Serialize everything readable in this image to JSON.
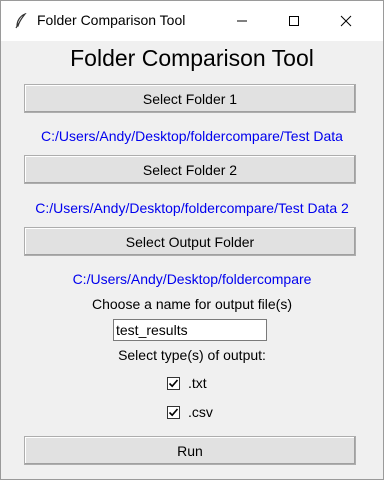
{
  "window": {
    "title": "Folder Comparison Tool",
    "icons": {
      "app": "feather-icon",
      "minimize": "minimize-icon",
      "maximize": "maximize-icon",
      "close": "close-icon"
    }
  },
  "main": {
    "heading": "Folder Comparison Tool",
    "select_folder1_label": "Select Folder 1",
    "folder1_path": "C:/Users/Andy/Desktop/foldercompare/Test Data",
    "select_folder2_label": "Select Folder 2",
    "folder2_path": "C:/Users/Andy/Desktop/foldercompare/Test Data 2",
    "select_output_label": "Select Output Folder",
    "output_path": "C:/Users/Andy/Desktop/foldercompare",
    "filename_prompt": "Choose a name for output file(s)",
    "filename_value": "test_results",
    "output_type_prompt": "Select type(s) of output:",
    "outputs": [
      {
        "label": ".txt",
        "checked": true
      },
      {
        "label": ".csv",
        "checked": true
      }
    ],
    "run_label": "Run"
  },
  "colors": {
    "path_text": "#0000ee",
    "window_bg": "#f0f0f0",
    "button_bg": "#e1e1e1"
  }
}
